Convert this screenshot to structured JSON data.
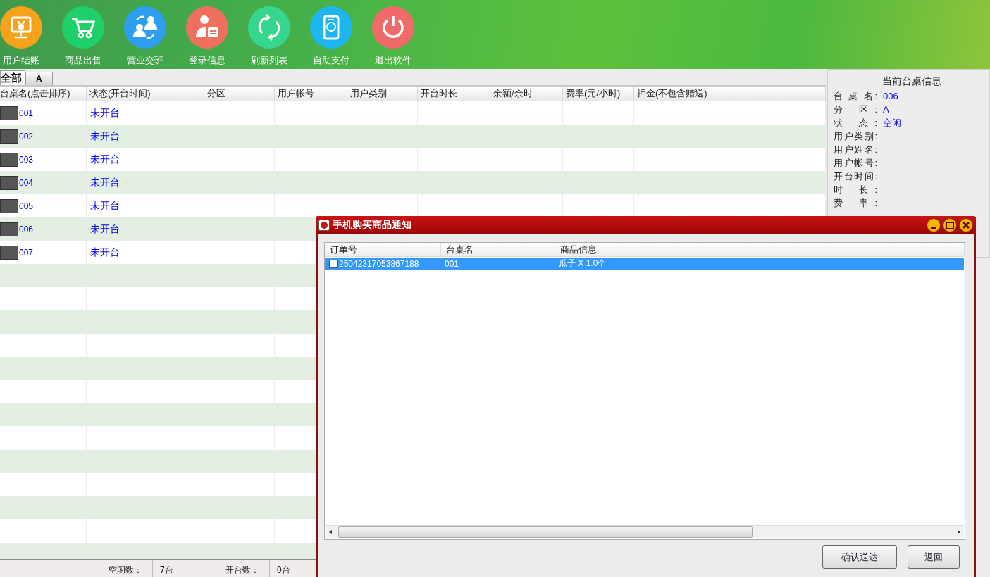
{
  "toolbar": [
    {
      "label": "用户结账",
      "color": "#f7a21b"
    },
    {
      "label": "商品出售",
      "color": "#1fcf6a"
    },
    {
      "label": "营业交班",
      "color": "#2e9ef0"
    },
    {
      "label": "登录信息",
      "color": "#f0705e"
    },
    {
      "label": "刷新列表",
      "color": "#36d68e"
    },
    {
      "label": "自助支付",
      "color": "#1eb6f0"
    },
    {
      "label": "退出软件",
      "color": "#f06a6a"
    }
  ],
  "tabs": [
    {
      "label": "全部",
      "selected": true
    },
    {
      "label": "A",
      "selected": false
    }
  ],
  "table": {
    "columns": [
      "台桌名(点击排序)",
      "状态(开台时间)",
      "分区",
      "用户帐号",
      "用户类别",
      "开台时长",
      "余额/余时",
      "费率(元/小时)",
      "押金(不包含赠送)"
    ],
    "rows": [
      {
        "name": "001",
        "status": "未开台"
      },
      {
        "name": "002",
        "status": "未开台"
      },
      {
        "name": "003",
        "status": "未开台"
      },
      {
        "name": "004",
        "status": "未开台"
      },
      {
        "name": "005",
        "status": "未开台"
      },
      {
        "name": "006",
        "status": "未开台"
      },
      {
        "name": "007",
        "status": "未开台"
      }
    ]
  },
  "side_panel": {
    "title": "当前台桌信息",
    "fields": [
      {
        "label": "台 桌 名:",
        "value": "006"
      },
      {
        "label": "分 区:",
        "value": "A"
      },
      {
        "label": "状 态:",
        "value": "空闲"
      },
      {
        "label": "用户类别:"
      },
      {
        "label": "用户姓名:"
      },
      {
        "label": "用户帐号:"
      },
      {
        "label": "开台时间:"
      },
      {
        "label": "时 长:"
      },
      {
        "label": "费 率:"
      }
    ]
  },
  "status_bar": [
    {
      "label": "空闲数：",
      "value": "7台"
    },
    {
      "label": "开台数：",
      "value": "0台"
    }
  ],
  "dialog": {
    "title": "手机购买商品通知",
    "columns": [
      "订单号",
      "台桌名",
      "商品信息"
    ],
    "rows": [
      {
        "checked": false,
        "selected": true,
        "cells": [
          "25042317053867188",
          "001",
          "瓜子 X 1.0个"
        ]
      }
    ],
    "buttons": [
      "确认送达",
      "返回"
    ]
  }
}
